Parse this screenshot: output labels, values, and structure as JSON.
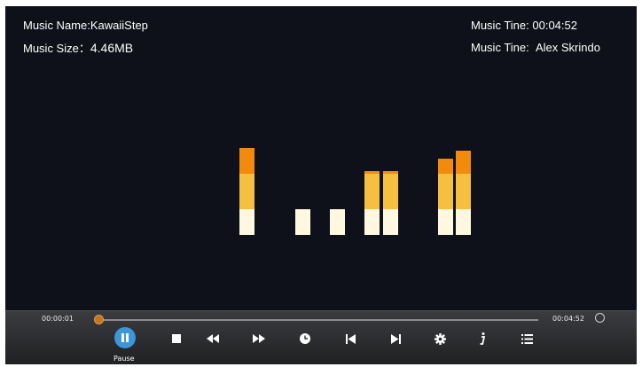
{
  "info": {
    "name_label": "Music Name:",
    "name_value": "KawaiiStep",
    "size_label": "Music Size：",
    "size_value": "4.46MB",
    "time_label": "Music Tine:",
    "time_value": "00:04:52",
    "artist_label": "Music Tine:",
    "artist_value": "Alex Skrindo"
  },
  "player": {
    "current_time": "00:00:01",
    "total_time": "00:04:52",
    "progress_fraction": 0.003,
    "pause_label": "Pause"
  },
  "visualizer": {
    "colors": {
      "low": "#fff8e1",
      "mid": "#f5c040",
      "high": "#f28a0c"
    },
    "bars": [
      {
        "low": 1,
        "mid": 1,
        "high": 1
      },
      {
        "low": 1,
        "mid": 0,
        "high": 0
      },
      {
        "low": 1,
        "mid": 0,
        "high": 0
      },
      {
        "low": 1,
        "mid": 1,
        "high": 0.1
      },
      {
        "low": 1,
        "mid": 1,
        "high": 0.1
      },
      {
        "low": 1,
        "mid": 1,
        "high": 0.6
      },
      {
        "low": 1,
        "mid": 1,
        "high": 0.9
      }
    ]
  },
  "icons": {
    "pause": "pause-icon",
    "stop": "stop-icon",
    "rewind": "rewind-icon",
    "fast_forward": "fast-forward-icon",
    "clock": "clock-icon",
    "previous": "skip-previous-icon",
    "next": "skip-next-icon",
    "settings": "gear-icon",
    "info": "info-icon",
    "playlist": "list-icon",
    "loop": "loop-icon"
  },
  "accent_color": "#3d96d8",
  "progress_color": "#c7761f"
}
